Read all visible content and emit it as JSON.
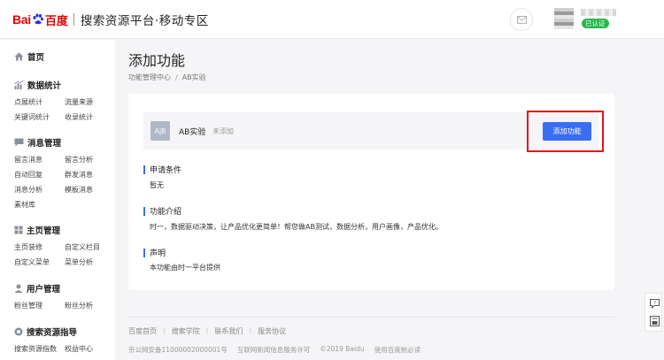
{
  "header": {
    "logo_bai": "Bai",
    "logo_du": "百度",
    "site_name": "搜索资源平台·移动专区",
    "verified_badge": "已认证"
  },
  "sidebar": {
    "home": "首页",
    "groups": [
      {
        "title": "数据统计",
        "items": [
          "点展统计",
          "流量来源",
          "关键词统计",
          "收录统计"
        ]
      },
      {
        "title": "消息管理",
        "items": [
          "留言消息",
          "留言分析",
          "自动回复",
          "群发消息",
          "消息分析",
          "模板消息",
          "素材库"
        ]
      },
      {
        "title": "主页管理",
        "items": [
          "主页装修",
          "自定义栏目",
          "自定义菜单",
          "菜单分析"
        ]
      },
      {
        "title": "用户管理",
        "items": [
          "粉丝管理",
          "粉丝分析"
        ]
      },
      {
        "title": "搜索资源指导",
        "items": [
          "搜索资源指数",
          "权益中心"
        ]
      }
    ]
  },
  "main": {
    "page_title": "添加功能",
    "breadcrumb": [
      "功能管理中心",
      "AB实验"
    ],
    "feature": {
      "icon_text": "A|B",
      "name": "AB实验",
      "status": "未添加",
      "button_label": "添加功能"
    },
    "sections": [
      {
        "title": "申请条件",
        "body": "暂无"
      },
      {
        "title": "功能介绍",
        "body": "时一，数据驱动决策，让产品优化更简单！帮您做AB测试，数据分析，用户画像，产品优化。"
      },
      {
        "title": "声明",
        "body": "本功能由时一平台提供"
      }
    ]
  },
  "footer": {
    "links": [
      "百度首页",
      "搜索学院",
      "联系我们",
      "服务协议"
    ],
    "copyright": [
      "京公网安备11000002000001号",
      "互联网新闻信息服务许可",
      "©2019 Baidu",
      "使用百度前必读"
    ]
  },
  "colors": {
    "brand_red": "#e10601",
    "primary_blue": "#3a6ef0",
    "highlight_red": "#e4141b",
    "verified_green": "#27b64a"
  }
}
